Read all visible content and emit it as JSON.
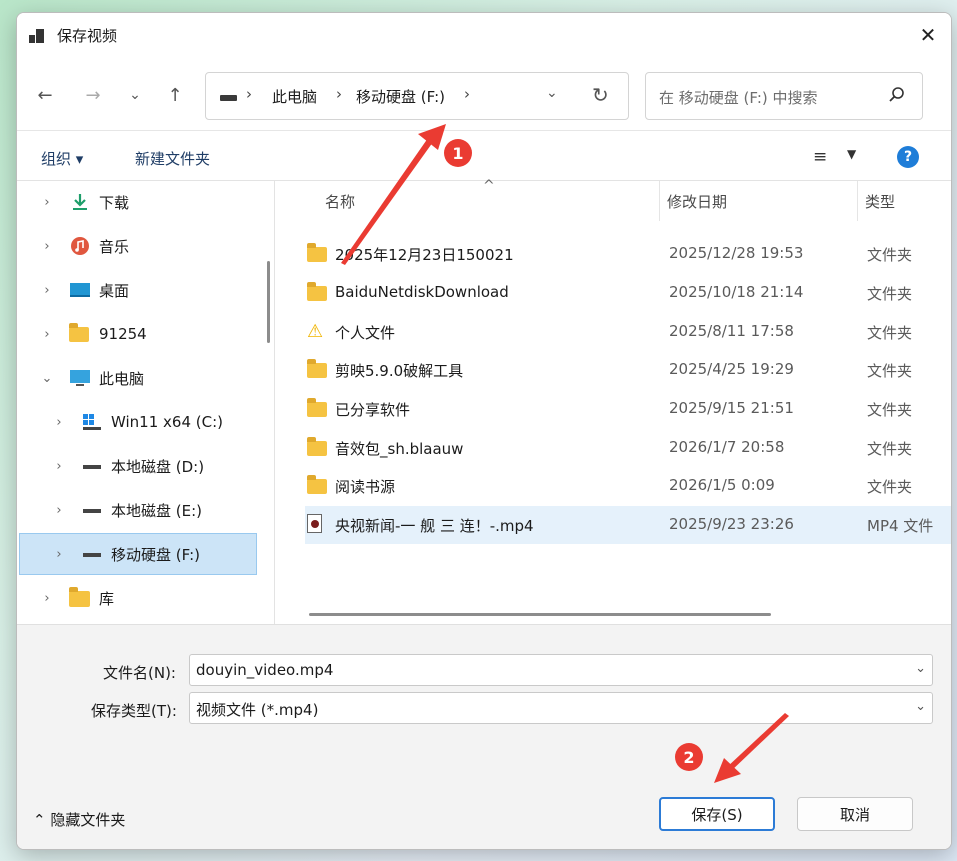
{
  "window": {
    "title": "保存视频",
    "close_glyph": "✕"
  },
  "nav": {
    "back_glyph": "←",
    "forward_glyph": "→",
    "recent_glyph": "⌄",
    "up_glyph": "↑",
    "breadcrumbs": [
      "此电脑",
      "移动硬盘 (F:)"
    ],
    "crumb_sep": "›",
    "dropdown_glyph": "⌄",
    "refresh_glyph": "↻"
  },
  "search": {
    "placeholder": "在 移动硬盘 (F:) 中搜索",
    "icon": "search-icon"
  },
  "toolbar": {
    "organize": "组织 ▾",
    "new_folder": "新建文件夹",
    "view_glyph": "≡",
    "view_dd": "▼",
    "help": "?"
  },
  "tree": [
    {
      "label": "下载",
      "icon": "download-icon",
      "chevron": "›",
      "indent": 0
    },
    {
      "label": "音乐",
      "icon": "music-icon",
      "chevron": "›",
      "indent": 0
    },
    {
      "label": "桌面",
      "icon": "desktop-icon",
      "chevron": "›",
      "indent": 0
    },
    {
      "label": "91254",
      "icon": "folder-icon",
      "chevron": "›",
      "indent": 0
    },
    {
      "label": "此电脑",
      "icon": "computer-icon",
      "chevron": "⌄",
      "indent": 0
    },
    {
      "label": "Win11 x64 (C:)",
      "icon": "windows-drive-icon",
      "chevron": "›",
      "indent": 1
    },
    {
      "label": "本地磁盘 (D:)",
      "icon": "drive-icon",
      "chevron": "›",
      "indent": 1
    },
    {
      "label": "本地磁盘 (E:)",
      "icon": "drive-icon",
      "chevron": "›",
      "indent": 1
    },
    {
      "label": "移动硬盘 (F:)",
      "icon": "drive-icon",
      "chevron": "›",
      "indent": 1,
      "selected": true
    },
    {
      "label": "库",
      "icon": "library-icon",
      "chevron": "›",
      "indent": 0
    }
  ],
  "columns": {
    "name": "名称",
    "date": "修改日期",
    "type": "类型",
    "sort_glyph": "^"
  },
  "files": [
    {
      "name": "2025年12月23日150021",
      "date": "2025/12/28 19:53",
      "type": "文件夹",
      "icon": "folder-icon"
    },
    {
      "name": "BaiduNetdiskDownload",
      "date": "2025/10/18 21:14",
      "type": "文件夹",
      "icon": "folder-icon"
    },
    {
      "name": "个人文件",
      "date": "2025/8/11 17:58",
      "type": "文件夹",
      "icon": "warning-icon"
    },
    {
      "name": "剪映5.9.0破解工具",
      "date": "2025/4/25 19:29",
      "type": "文件夹",
      "icon": "folder-icon"
    },
    {
      "name": "已分享软件",
      "date": "2025/9/15 21:51",
      "type": "文件夹",
      "icon": "folder-icon"
    },
    {
      "name": "音效包_sh.blaauw",
      "date": "2026/1/7 20:58",
      "type": "文件夹",
      "icon": "folder-icon"
    },
    {
      "name": "阅读书源",
      "date": "2026/1/5 0:09",
      "type": "文件夹",
      "icon": "folder-icon"
    },
    {
      "name": "央视新闻-一 舰 三 连！-.mp4",
      "date": "2025/9/23 23:26",
      "type": "MP4 文件",
      "icon": "video-file-icon",
      "selected": true
    }
  ],
  "form": {
    "filename_label": "文件名(N):",
    "filename_value": "douyin_video.mp4",
    "filetype_label": "保存类型(T):",
    "filetype_value": "视频文件 (*.mp4)",
    "dd_glyph": "⌄"
  },
  "footer": {
    "hide_folders": "⌃  隐藏文件夹",
    "save": "保存(S)",
    "cancel": "取消"
  },
  "annotations": {
    "badge1": "1",
    "badge2": "2",
    "arrow_color": "#ea3b32"
  }
}
